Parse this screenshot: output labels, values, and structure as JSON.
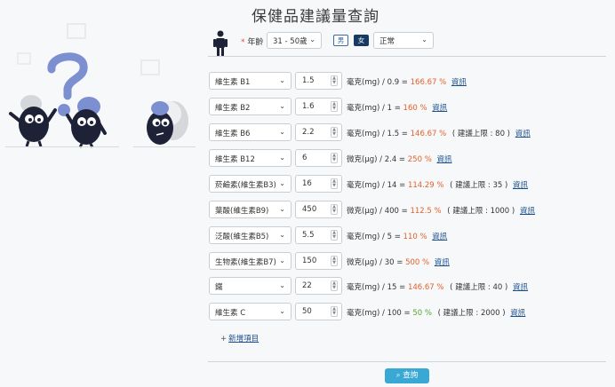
{
  "page": {
    "title": "保健品建議量查詢"
  },
  "form": {
    "required_star": "*",
    "age_label": "年齡",
    "age_value": "31 - 50歲",
    "gender_male": "男",
    "gender_female": "女",
    "gender_selected": "女",
    "condition_value": "正常"
  },
  "rows": [
    {
      "nutrient": "維生素 B1",
      "amount": "1.5",
      "unit": "毫克(mg)",
      "rda": "/ 0.9 =",
      "pct": "166.67 %",
      "pct_color": "orange",
      "upper": "",
      "link": "資訊"
    },
    {
      "nutrient": "維生素 B2",
      "amount": "1.6",
      "unit": "毫克(mg)",
      "rda": "/ 1 =",
      "pct": "160 %",
      "pct_color": "orange",
      "upper": "",
      "link": "資訊"
    },
    {
      "nutrient": "維生素 B6",
      "amount": "2.2",
      "unit": "毫克(mg)",
      "rda": "/ 1.5 =",
      "pct": "146.67 %",
      "pct_color": "orange",
      "upper": "( 建議上限 : 80 )",
      "link": "資訊"
    },
    {
      "nutrient": "維生素 B12",
      "amount": "6",
      "unit": "微克(μg)",
      "rda": "/ 2.4 =",
      "pct": "250 %",
      "pct_color": "orange",
      "upper": "",
      "link": "資訊"
    },
    {
      "nutrient": "菸鹼素(維生素B3)",
      "amount": "16",
      "unit": "毫克(mg)",
      "rda": "/ 14 =",
      "pct": "114.29 %",
      "pct_color": "orange",
      "upper": "( 建議上限 : 35 )",
      "link": "資訊"
    },
    {
      "nutrient": "葉酸(維生素B9)",
      "amount": "450",
      "unit": "微克(μg)",
      "rda": "/ 400 =",
      "pct": "112.5 %",
      "pct_color": "orange",
      "upper": "( 建議上限 : 1000 )",
      "link": "資訊"
    },
    {
      "nutrient": "泛酸(維生素B5)",
      "amount": "5.5",
      "unit": "毫克(mg)",
      "rda": "/ 5 =",
      "pct": "110 %",
      "pct_color": "orange",
      "upper": "",
      "link": "資訊"
    },
    {
      "nutrient": "生物素(維生素B7)",
      "amount": "150",
      "unit": "微克(μg)",
      "rda": "/ 30 =",
      "pct": "500 %",
      "pct_color": "orange",
      "upper": "",
      "link": "資訊"
    },
    {
      "nutrient": "鐵",
      "amount": "22",
      "unit": "毫克(mg)",
      "rda": "/ 15 =",
      "pct": "146.67 %",
      "pct_color": "orange",
      "upper": "( 建議上限 : 40 )",
      "link": "資訊"
    },
    {
      "nutrient": "維生素 C",
      "amount": "50",
      "unit": "毫克(mg)",
      "rda": "/ 100 =",
      "pct": "50 %",
      "pct_color": "green",
      "upper": "( 建議上限 : 2000 )",
      "link": "資訊"
    }
  ],
  "actions": {
    "add_item": "新增項目",
    "search": "查詢"
  },
  "colors": {
    "orange": "#e5602a",
    "green": "#5aa531",
    "accent": "#3aa8d4",
    "navy": "#163a63"
  },
  "icons": {
    "person": "person-standing-icon",
    "chevron": "chevron-down-icon",
    "search": "search-icon",
    "plus": "plus-icon"
  }
}
